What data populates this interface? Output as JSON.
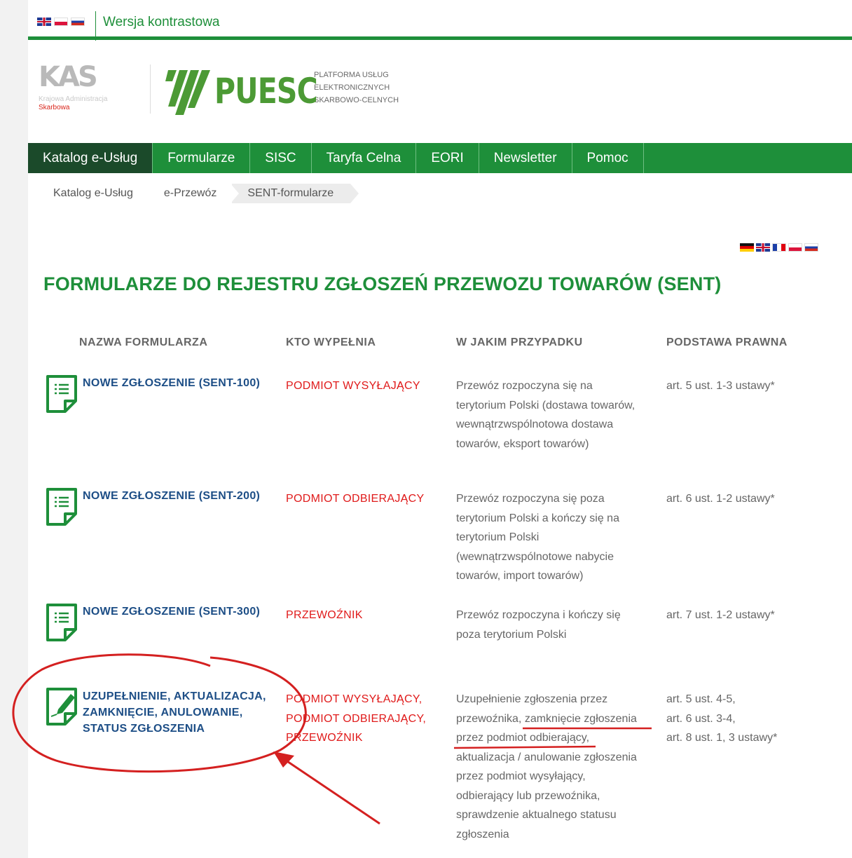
{
  "topbar": {
    "languages": [
      "English",
      "Polski",
      "Русский"
    ],
    "contrast_label": "Wersja kontrastowa"
  },
  "kas_logo": {
    "mark": "KAS",
    "line1": "Krajowa Administracja",
    "line2": "Skarbowa",
    "accent_color": "#d9261c"
  },
  "puesc_logo": {
    "name": "PUESC",
    "subtitle": [
      "PLATFORMA USŁUG",
      "ELEKTRONICZNYCH",
      "SKARBOWO-CELNYCH"
    ]
  },
  "nav": {
    "items": [
      {
        "label": "Katalog e-Usług",
        "active": true
      },
      {
        "label": "Formularze"
      },
      {
        "label": "SISC"
      },
      {
        "label": "Taryfa Celna"
      },
      {
        "label": "EORI"
      },
      {
        "label": "Newsletter"
      },
      {
        "label": "Pomoc"
      }
    ]
  },
  "breadcrumb": [
    "Katalog e-Usług",
    "e-Przewóz",
    "SENT-formularze"
  ],
  "content_languages": [
    "Deutsch",
    "English",
    "Français",
    "Polski",
    "Русский"
  ],
  "page_title": "FORMULARZE DO REJESTRU ZGŁOSZEŃ PRZEWOZU TOWARÓW (SENT)",
  "table": {
    "headers": [
      "NAZWA FORMULARZA",
      "KTO WYPEŁNIA",
      "W JAKIM PRZYPADKU",
      "PODSTAWA PRAWNA"
    ],
    "rows": [
      {
        "name": "NOWE ZGŁOSZENIE (SENT-100)",
        "who": [
          "PODMIOT WYSYŁAJĄCY"
        ],
        "when": [
          "Przewóz rozpoczyna się na",
          "terytorium Polski (dostawa towarów,",
          "wewnątrzwspólnotowa dostawa",
          "towarów, eksport towarów)"
        ],
        "law": [
          "art. 5 ust. 1-3 ustawy*"
        ]
      },
      {
        "name": "NOWE ZGŁOSZENIE (SENT-200)",
        "who": [
          "PODMIOT ODBIERAJĄCY"
        ],
        "when": [
          "Przewóz rozpoczyna się poza",
          "terytorium Polski a kończy się na",
          "terytorium Polski",
          "(wewnątrzwspólnotowe nabycie",
          "towarów, import towarów)"
        ],
        "law": [
          "art. 6 ust. 1-2 ustawy*"
        ]
      },
      {
        "name": "NOWE ZGŁOSZENIE (SENT-300)",
        "who": [
          "PRZEWOŹNIK"
        ],
        "when": [
          "Przewóz rozpoczyna i kończy się",
          "poza terytorium Polski"
        ],
        "law": [
          "art. 7 ust. 1-2 ustawy*"
        ]
      },
      {
        "name": [
          "UZUPEŁNIENIE, AKTUALIZACJA,",
          "ZAMKNIĘCIE, ANULOWANIE,",
          "STATUS ZGŁOSZENIA"
        ],
        "who": [
          "PODMIOT WYSYŁAJĄCY,",
          "PODMIOT ODBIERAJĄCY,",
          "PRZEWOŹNIK"
        ],
        "when": [
          "Uzupełnienie zgłoszenia przez",
          "przewoźnika, zamknięcie zgłoszenia",
          "przez podmiot odbierający,",
          "aktualizacja / anulowanie zgłoszenia",
          "przez podmiot wysyłający,",
          "odbierający lub przewoźnika,",
          "sprawdzenie aktualnego statusu",
          "zgłoszenia"
        ],
        "law": [
          "art. 5 ust. 4-5,",
          "art. 6 ust. 3-4,",
          "art. 8 ust. 1, 3 ustawy*"
        ]
      }
    ]
  },
  "colors": {
    "brand_green": "#1e8f3a",
    "nav_active": "#1b4a2a",
    "link_blue": "#1d4e86",
    "who_red": "#e01b1b",
    "annotation_red": "#d42020"
  },
  "icons": [
    "document-list-icon",
    "document-edit-icon"
  ]
}
